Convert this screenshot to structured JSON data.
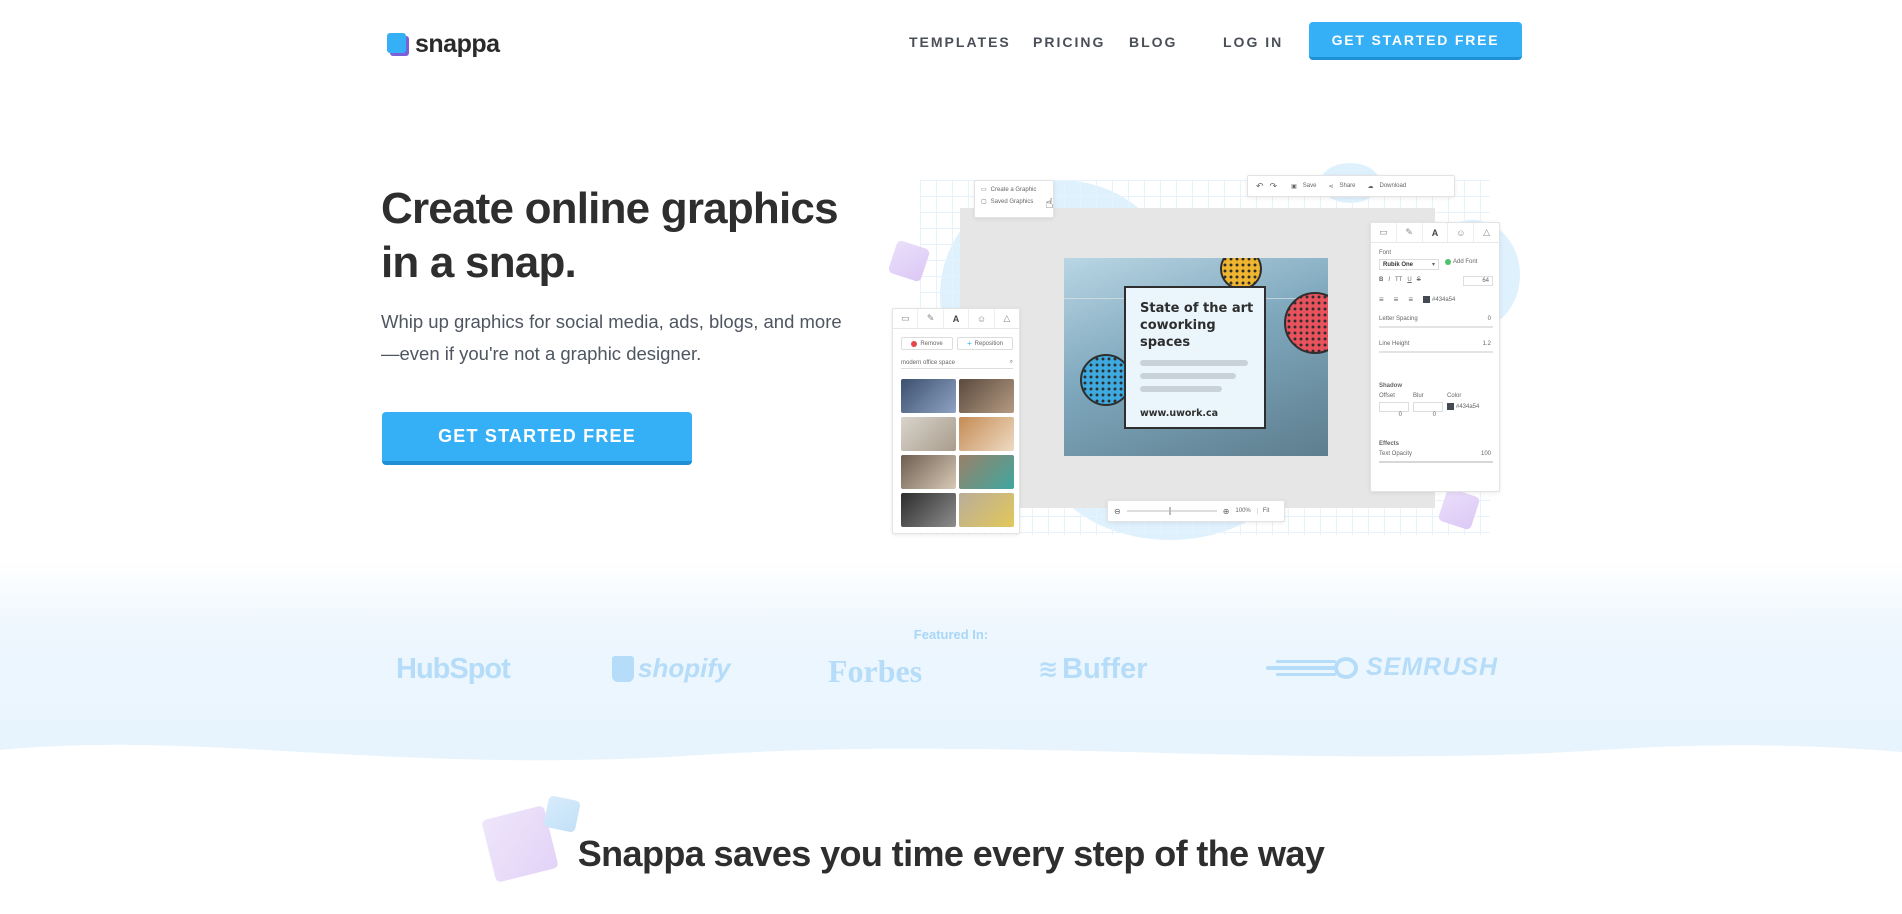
{
  "nav": {
    "logo_text": "snappa",
    "links": [
      "TEMPLATES",
      "PRICING",
      "BLOG",
      "LOG IN"
    ],
    "cta": "GET STARTED FREE"
  },
  "hero": {
    "title": "Create online graphics in a snap.",
    "subtitle": "Whip up graphics for social media, ads, blogs, and more—even if you're not a graphic designer.",
    "cta": "GET STARTED FREE"
  },
  "mockup": {
    "create_menu": [
      "Create a Graphic",
      "Saved Graphics"
    ],
    "topbar": [
      "Save",
      "Share",
      "Download"
    ],
    "left_panel": {
      "remove": "Remove",
      "reposition": "Reposition",
      "search_value": "modern office space"
    },
    "artwork": {
      "title": "State of the art coworking spaces",
      "url": "www.uwork.ca"
    },
    "right_panel": {
      "font_label": "Font",
      "font_value": "Rubik One",
      "add_font": "Add Font",
      "font_size": "64",
      "color_hex": "#434a54",
      "letter_spacing_label": "Letter Spacing",
      "letter_spacing_value": "0",
      "line_height_label": "Line Height",
      "line_height_value": "1.2",
      "shadow_label": "Shadow",
      "offset_label": "Offset",
      "blur_label": "Blur",
      "color_label": "Color",
      "offset_value": "0",
      "blur_value": "0",
      "shadow_color": "#434a54",
      "effects_label": "Effects",
      "text_opacity_label": "Text Opacity",
      "text_opacity_value": "100"
    },
    "zoom": {
      "level": "100%",
      "fit": "Fit"
    }
  },
  "featured": {
    "label": "Featured In:",
    "brands": [
      "HubSpot",
      "shopify",
      "Forbes",
      "Buffer",
      "SEMRUSH"
    ]
  },
  "section2": {
    "title": "Snappa saves you time every step of the way"
  },
  "colors": {
    "accent": "#35aff5",
    "text_dark": "#2e2e2e",
    "brand_light": "#b5dcf8"
  }
}
